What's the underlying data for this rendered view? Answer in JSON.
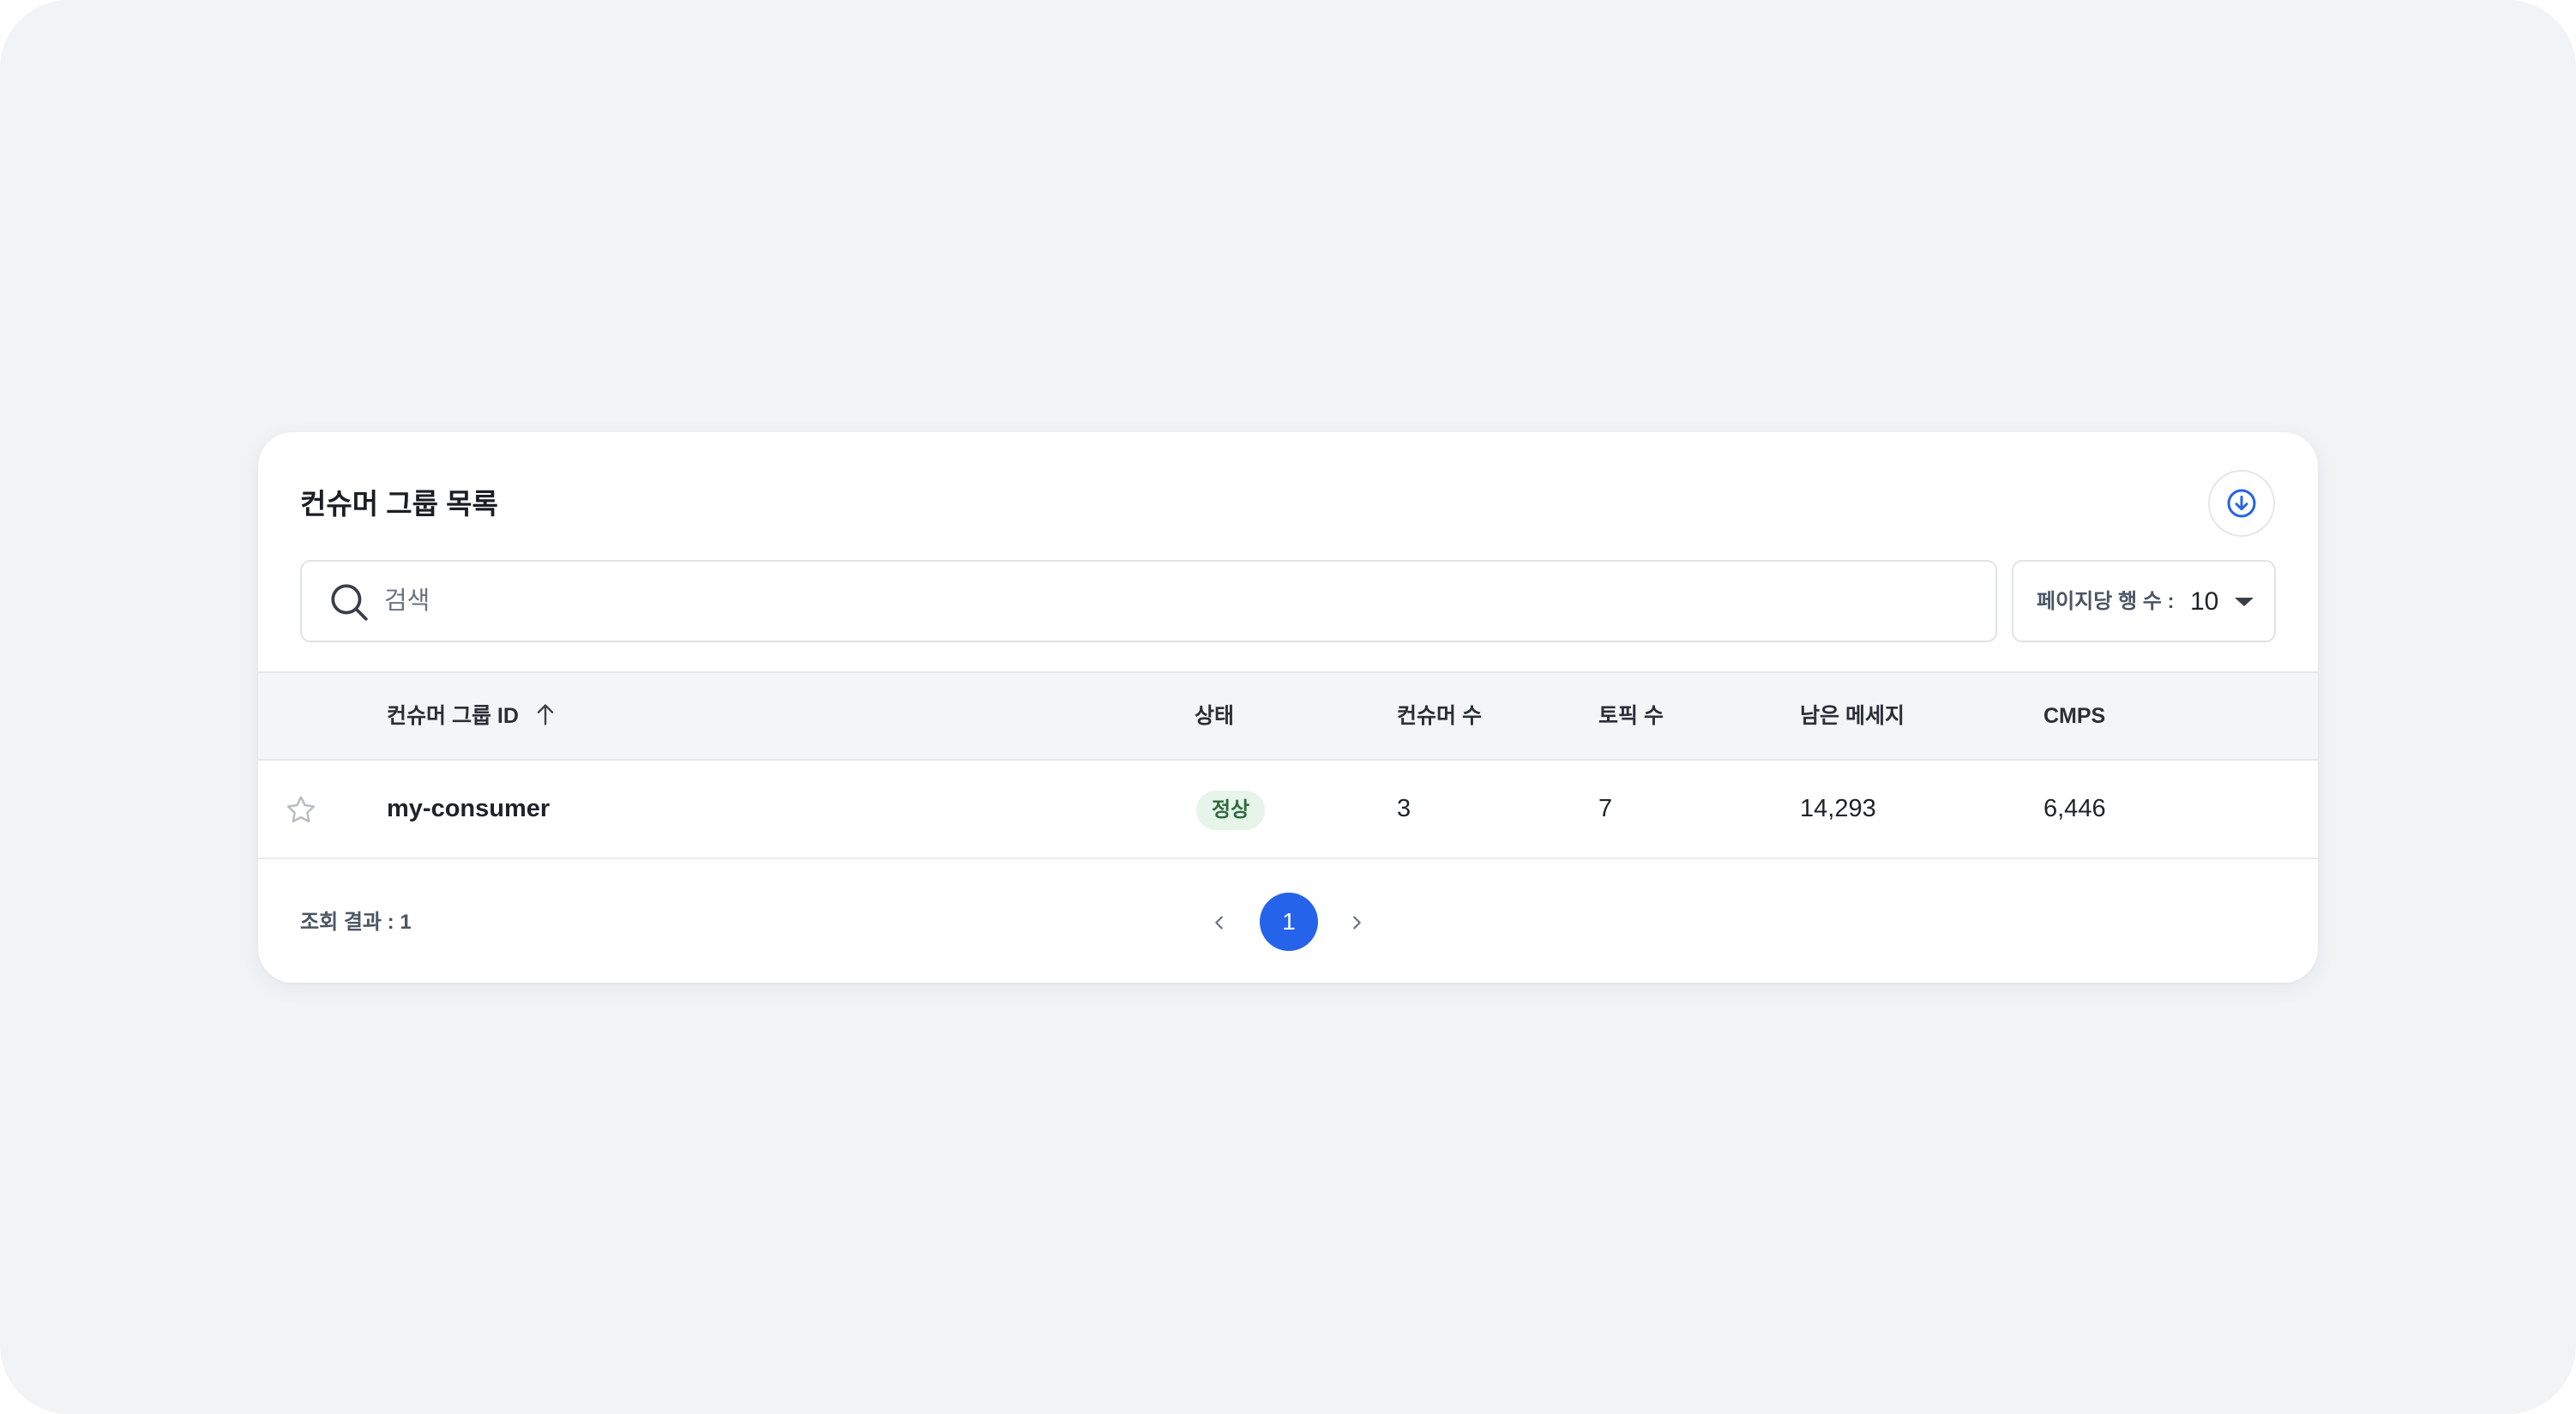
{
  "panel": {
    "title": "컨슈머 그룹 목록",
    "download_icon": "download-circle-icon"
  },
  "search": {
    "icon": "search-icon",
    "placeholder": "검색",
    "value": ""
  },
  "rows_per_page": {
    "label": "페이지당 행 수 :",
    "value": "10",
    "icon": "caret-down-icon"
  },
  "table": {
    "columns": [
      {
        "label": "컨슈머 그룹 ID",
        "sorted": "ascending",
        "sort_icon": "arrow-up-icon"
      },
      {
        "label": "상태"
      },
      {
        "label": "컨슈머 수"
      },
      {
        "label": "토픽 수"
      },
      {
        "label": "남은 메세지"
      },
      {
        "label": "CMPS"
      }
    ],
    "rows": [
      {
        "favorite_icon": "star-outline-icon",
        "favorite": false,
        "id": "my-consumer",
        "status": "정상",
        "consumers": "3",
        "topics": "7",
        "remaining_messages": "14,293",
        "cmps": "6,446"
      }
    ]
  },
  "footer": {
    "result_count": "조회 결과 : 1",
    "pagination": {
      "prev_icon": "chevron-left-icon",
      "next_icon": "chevron-right-icon",
      "current_page": "1"
    }
  },
  "colors": {
    "accent": "#2563eb",
    "status_bg": "#e6f4ea",
    "status_text": "#2f6b3d",
    "page_background": "#f2f3f5",
    "header_background": "#f4f5f7"
  }
}
